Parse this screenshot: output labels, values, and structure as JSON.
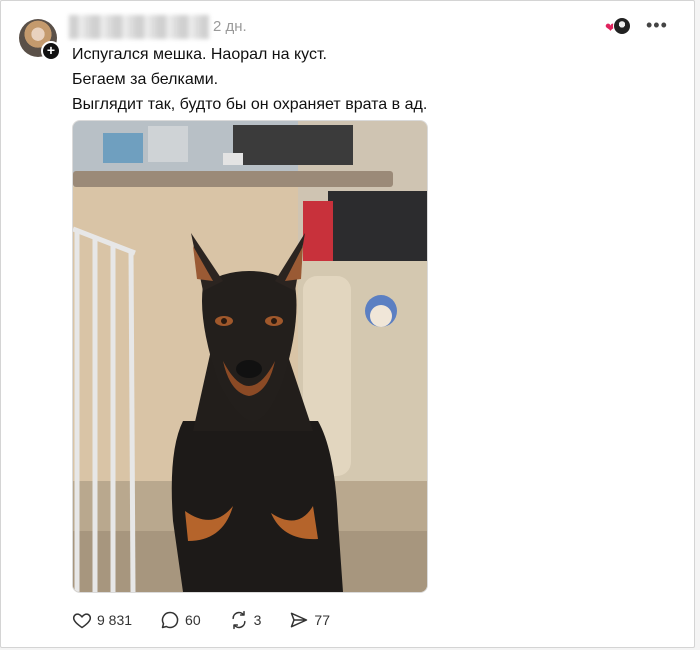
{
  "post": {
    "time": "2 дн.",
    "lines": [
      "Испугался мешка. Наорал на куст.",
      "Бегаем за белками.",
      "Выглядит так, будто бы он охраняет врата в ад."
    ],
    "photo_icon": "doberman-photo",
    "actions": {
      "likes": "9 831",
      "comments": "60",
      "reposts": "3",
      "shares": "77"
    }
  },
  "colors": {
    "heart": "#e0245e",
    "text": "#101010",
    "muted": "#9a9a9a"
  }
}
